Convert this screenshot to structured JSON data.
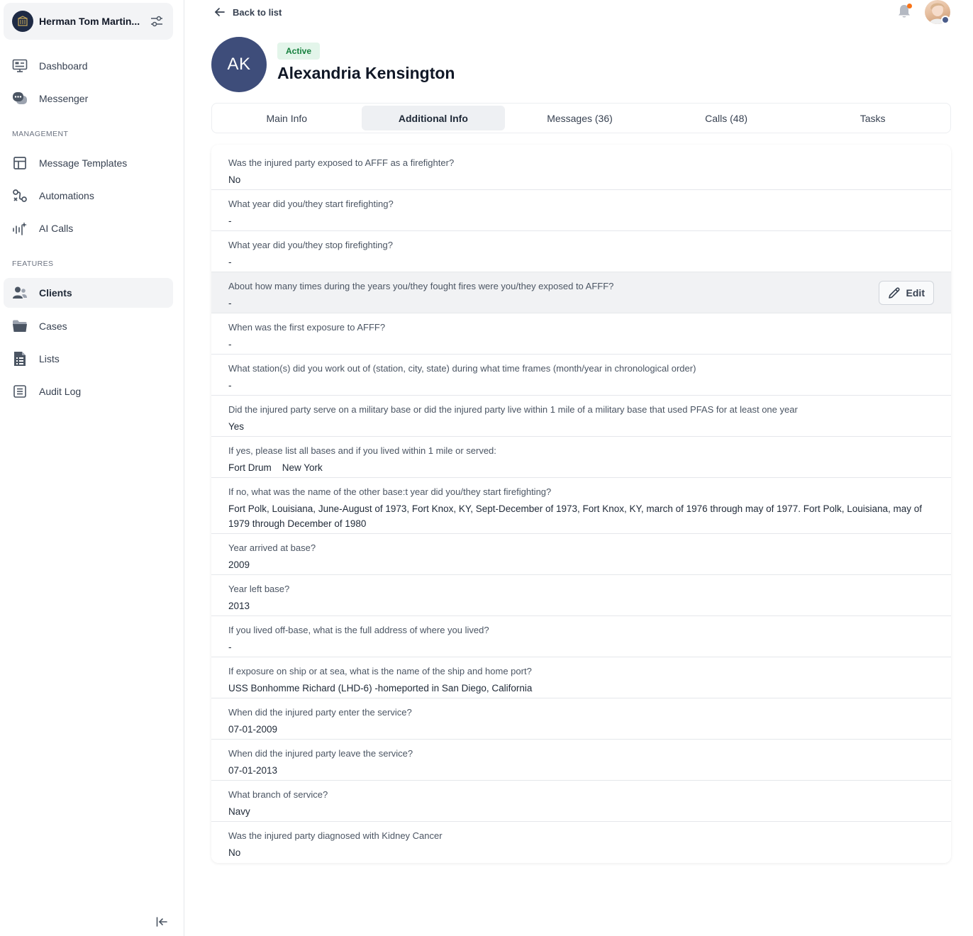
{
  "sidebar": {
    "org_name": "Herman Tom Martin...",
    "nav_main": [
      {
        "label": "Dashboard",
        "icon": "monitor-icon"
      },
      {
        "label": "Messenger",
        "icon": "chat-icon"
      }
    ],
    "management_label": "MANAGEMENT",
    "nav_management": [
      {
        "label": "Message Templates",
        "icon": "template-icon"
      },
      {
        "label": "Automations",
        "icon": "automation-icon"
      },
      {
        "label": "AI Calls",
        "icon": "ai-calls-icon"
      }
    ],
    "features_label": "FEATURES",
    "nav_features": [
      {
        "label": "Clients",
        "icon": "users-icon",
        "active": true
      },
      {
        "label": "Cases",
        "icon": "folder-icon"
      },
      {
        "label": "Lists",
        "icon": "list-file-icon"
      },
      {
        "label": "Audit Log",
        "icon": "log-icon"
      }
    ]
  },
  "header": {
    "back_label": "Back to list",
    "notification_color": "#f97316"
  },
  "client": {
    "initials": "AK",
    "status": "Active",
    "name": "Alexandria Kensington",
    "avatar_color": "#3e4d7a"
  },
  "tabs": [
    {
      "label": "Main Info"
    },
    {
      "label": "Additional Info",
      "active": true
    },
    {
      "label": "Messages (36)"
    },
    {
      "label": "Calls (48)"
    },
    {
      "label": "Tasks"
    }
  ],
  "edit_label": "Edit",
  "fields": [
    {
      "q": "Was the injured party exposed to AFFF as a firefighter?",
      "a": "No"
    },
    {
      "q": "What year did you/they start firefighting?",
      "a": "-"
    },
    {
      "q": "What year did you/they stop firefighting?",
      "a": "-"
    },
    {
      "q": "About how many times during the years you/they fought fires were you/they exposed to AFFF?",
      "a": "-"
    },
    {
      "q": "When was the first exposure to AFFF?",
      "a": "-"
    },
    {
      "q": "What station(s) did you work out of  (station, city, state) during what time frames (month/year in chronological order)",
      "a": "-"
    },
    {
      "q": "Did the injured party serve on a military base or did the injured party live within 1 mile of a military base that used PFAS for at least one year",
      "a": "Yes"
    },
    {
      "q": "If yes, please list all bases and if you lived within 1 mile or served:",
      "a": "Fort Drum    New York"
    },
    {
      "q": "If no, what was the name of the other base:t year did you/they start firefighting?",
      "a": "Fort Polk, Louisiana, June-August of 1973, Fort Knox, KY, Sept-December of 1973,  Fort Knox, KY, march of 1976 through may of 1977. Fort Polk, Louisiana, may of 1979 through December of 1980"
    },
    {
      "q": "Year arrived at base?",
      "a": "2009"
    },
    {
      "q": "Year left base?",
      "a": "2013"
    },
    {
      "q": "If you lived off-base, what is the full address of where you lived?",
      "a": "-"
    },
    {
      "q": "If exposure on ship or at sea, what is the name of the ship and home port?",
      "a": "USS Bonhomme Richard (LHD-6) -homeported in San Diego, California"
    },
    {
      "q": "When did the injured party enter the service?",
      "a": "07-01-2009"
    },
    {
      "q": "When did the injured party leave the service?",
      "a": "07-01-2013"
    },
    {
      "q": "What branch of service?",
      "a": "Navy"
    },
    {
      "q": "Was the injured party diagnosed with Kidney Cancer",
      "a": "No"
    }
  ]
}
